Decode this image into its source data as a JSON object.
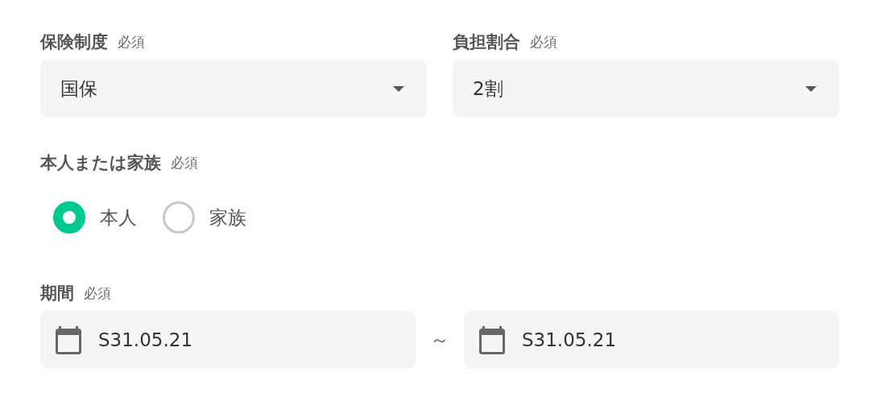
{
  "selects": [
    {
      "label": "保険制度",
      "required": "必須",
      "value": "国保"
    },
    {
      "label": "負担割合",
      "required": "必須",
      "value": "2割"
    }
  ],
  "relation": {
    "label": "本人または家族",
    "required": "必須",
    "options": [
      {
        "label": "本人",
        "selected": true
      },
      {
        "label": "家族",
        "selected": false
      }
    ]
  },
  "period": {
    "label": "期間",
    "required": "必須",
    "from": "S31.05.21",
    "separator": "～",
    "to": "S31.05.21"
  }
}
